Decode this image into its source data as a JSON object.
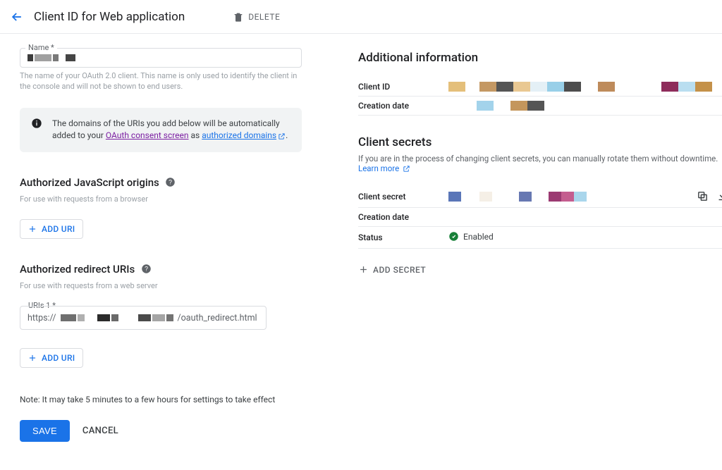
{
  "header": {
    "title": "Client ID for Web application",
    "delete_label": "DELETE"
  },
  "name_field": {
    "label": "Name *",
    "helper": "The name of your OAuth 2.0 client. This name is only used to identify the client in the console and will not be shown to end users."
  },
  "notice": {
    "prefix": "The domains of the URIs you add below will be automatically added to your ",
    "link1": "OAuth consent screen",
    "mid": " as ",
    "link2": "authorized domains",
    "suffix": "."
  },
  "js_origins": {
    "heading": "Authorized JavaScript origins",
    "subtext": "For use with requests from a browser",
    "add_label": "ADD URI"
  },
  "redirect_uris": {
    "heading": "Authorized redirect URIs",
    "subtext": "For use with requests from a web server",
    "field_label": "URIs 1 *",
    "value_prefix": "https://",
    "value_suffix": "/oauth_redirect.html",
    "add_label": "ADD URI"
  },
  "note": "Note: It may take 5 minutes to a few hours for settings to take effect",
  "buttons": {
    "save": "SAVE",
    "cancel": "CANCEL"
  },
  "right": {
    "heading": "Additional information",
    "client_id_label": "Client ID",
    "creation_date_label": "Creation date",
    "secrets_heading": "Client secrets",
    "secrets_desc_prefix": "If you are in the process of changing client secrets, you can manually rotate them without downtime. ",
    "learn_more": "Learn more",
    "client_secret_label": "Client secret",
    "status_label": "Status",
    "status_value": "Enabled",
    "add_secret_label": "ADD SECRET"
  }
}
